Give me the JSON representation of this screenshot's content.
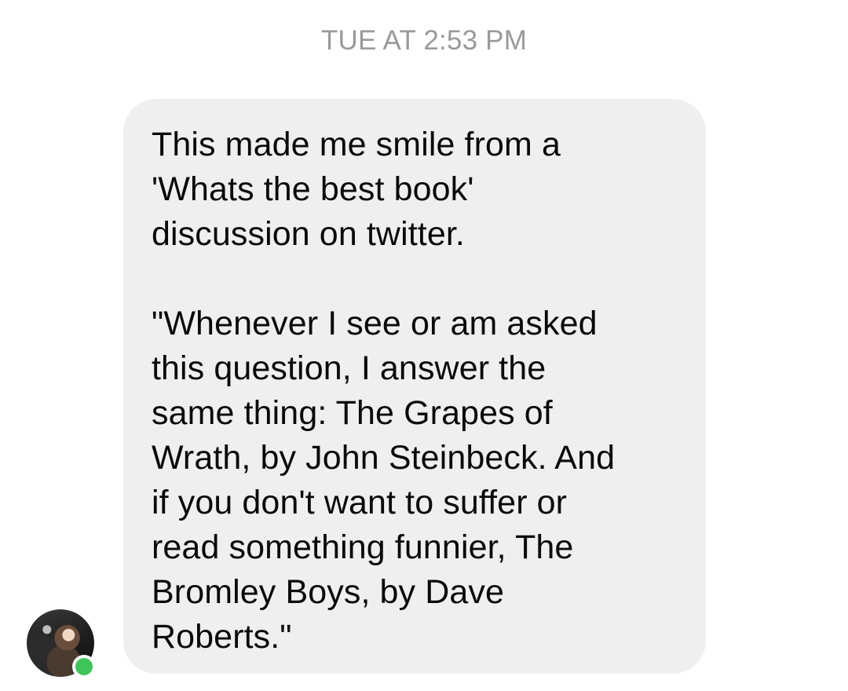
{
  "conversation": {
    "timestamp": "TUE AT 2:53 PM",
    "message": {
      "sender_status": "online",
      "text": "This made me smile from a\n'Whats the best book'\ndiscussion on twitter.\n\n\"Whenever I see or am asked\nthis question, I answer the\nsame thing: The Grapes of\nWrath, by John Steinbeck. And\nif you don't want to suffer or\nread something funnier, The\nBromley Boys, by Dave\nRoberts.\""
    }
  },
  "colors": {
    "background": "#ffffff",
    "bubble": "#efefef",
    "timestamp_text": "#9a9a9a",
    "message_text": "#0a0a0a",
    "online_indicator": "#3dc55a"
  }
}
